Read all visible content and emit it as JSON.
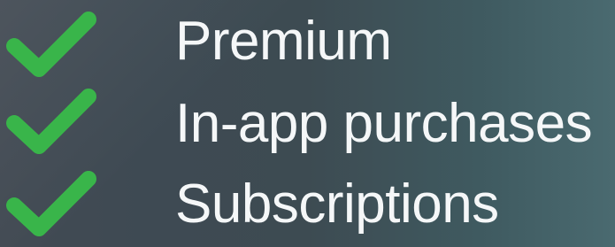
{
  "features": {
    "items": [
      {
        "label": "Premium",
        "icon": "checkmark-icon"
      },
      {
        "label": "In-app purchases",
        "icon": "checkmark-icon"
      },
      {
        "label": "Subscriptions",
        "icon": "checkmark-icon"
      }
    ],
    "check_color": "#39b54a",
    "text_color": "#f5f7f8",
    "background": "#3d4b52"
  }
}
